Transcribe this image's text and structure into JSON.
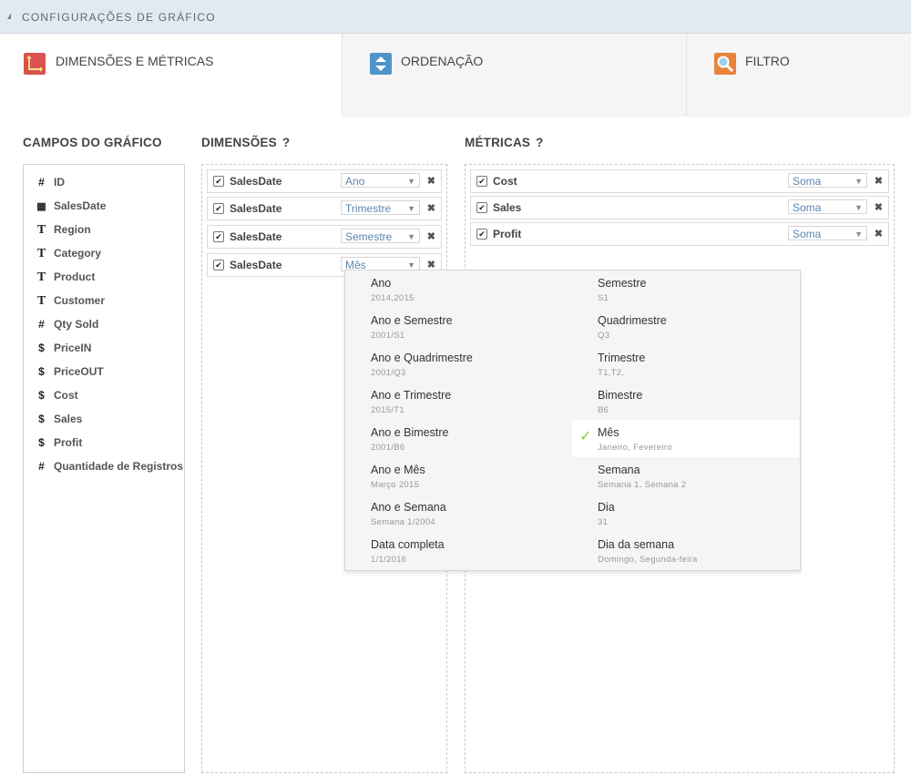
{
  "header": {
    "title": "CONFIGURAÇÕES DE GRÁFICO"
  },
  "tabs": [
    {
      "label": "DIMENSÕES E MÉTRICAS",
      "icon": "axes-icon",
      "color": "#d9534f"
    },
    {
      "label": "ORDENAÇÃO",
      "icon": "sort-icon",
      "color": "#4f94c8"
    },
    {
      "label": "FILTRO",
      "icon": "search-icon",
      "color": "#e8833a"
    }
  ],
  "sections": {
    "fields_title": "CAMPOS DO GRÁFICO",
    "dimensions_title": "DIMENSÕES",
    "metrics_title": "MÉTRICAS",
    "help": "?"
  },
  "fields": [
    {
      "label": "ID",
      "icon": "#"
    },
    {
      "label": "SalesDate",
      "icon": "▦"
    },
    {
      "label": "Region",
      "icon": "T"
    },
    {
      "label": "Category",
      "icon": "T"
    },
    {
      "label": "Product",
      "icon": "T"
    },
    {
      "label": "Customer",
      "icon": "T"
    },
    {
      "label": "Qty Sold",
      "icon": "#"
    },
    {
      "label": "PriceIN",
      "icon": "$"
    },
    {
      "label": "PriceOUT",
      "icon": "$"
    },
    {
      "label": "Cost",
      "icon": "$"
    },
    {
      "label": "Sales",
      "icon": "$"
    },
    {
      "label": "Profit",
      "icon": "$"
    },
    {
      "label": "Quantidade de Registros",
      "icon": "#"
    }
  ],
  "dimensions": [
    {
      "name": "SalesDate",
      "value": "Ano"
    },
    {
      "name": "SalesDate",
      "value": "Trimestre"
    },
    {
      "name": "SalesDate",
      "value": "Semestre"
    },
    {
      "name": "SalesDate",
      "value": "Mês"
    }
  ],
  "metrics": [
    {
      "name": "Cost",
      "value": "Soma"
    },
    {
      "name": "Sales",
      "value": "Soma"
    },
    {
      "name": "Profit",
      "value": "Soma"
    }
  ],
  "dropdown": {
    "left": [
      {
        "label": "Ano",
        "sample": "2014,2015"
      },
      {
        "label": "Ano e Semestre",
        "sample": "2001/S1"
      },
      {
        "label": "Ano e Quadrimestre",
        "sample": "2001/Q3"
      },
      {
        "label": "Ano e Trimestre",
        "sample": "2015/T1"
      },
      {
        "label": "Ano e Bimestre",
        "sample": "2001/B6"
      },
      {
        "label": "Ano e Mês",
        "sample": "Março 2015"
      },
      {
        "label": "Ano e Semana",
        "sample": "Semana 1/2004"
      },
      {
        "label": "Data completa",
        "sample": "1/1/2016"
      }
    ],
    "right": [
      {
        "label": "Semestre",
        "sample": "S1"
      },
      {
        "label": "Quadrimestre",
        "sample": "Q3"
      },
      {
        "label": "Trimestre",
        "sample": "T1,T2,"
      },
      {
        "label": "Bimestre",
        "sample": "B6"
      },
      {
        "label": "Mês",
        "sample": "Janeiro, Fevereiro",
        "selected": true
      },
      {
        "label": "Semana",
        "sample": "Semana 1, Semana 2"
      },
      {
        "label": "Dia",
        "sample": "31"
      },
      {
        "label": "Dia da semana",
        "sample": "Domingo, Segunda-feira"
      }
    ]
  },
  "colors": {
    "accent_check": "#8ec63f",
    "select_text": "#5b86b0",
    "header_bg": "#e3e9f0"
  }
}
